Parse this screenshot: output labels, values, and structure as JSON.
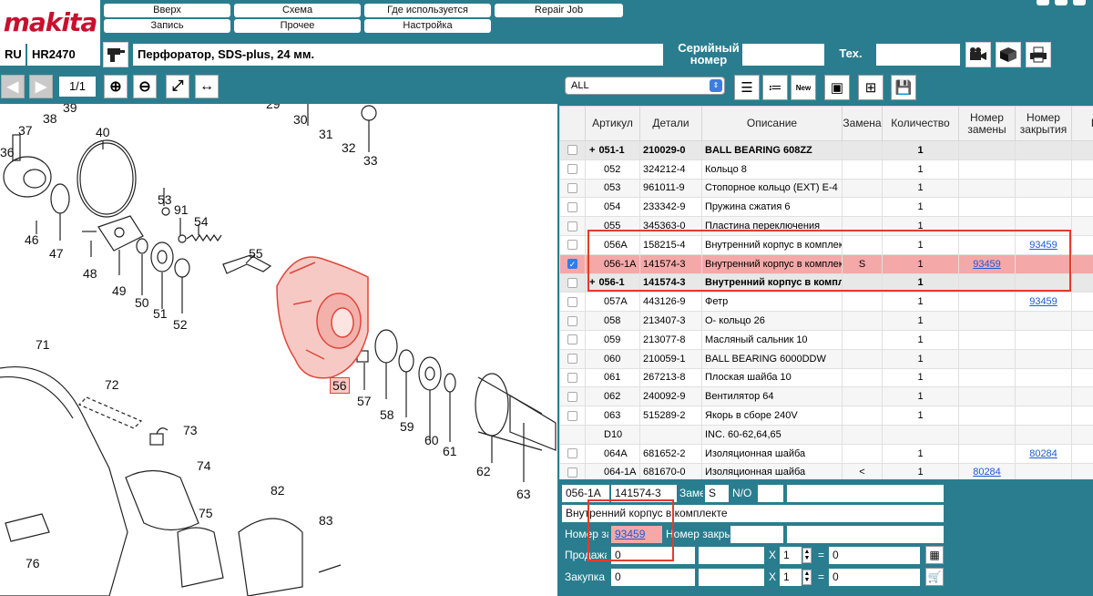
{
  "logo": {
    "brand": "makita"
  },
  "menu": {
    "up": "Вверх",
    "scheme": "Схема",
    "where_used": "Где используется",
    "repair_job": "Repair Job",
    "record": "Запись",
    "other": "Прочее",
    "settings": "Настройка"
  },
  "model_row": {
    "lang": "RU",
    "model": "HR2470",
    "description": "Перфоратор, SDS-plus, 24 мм.",
    "serial_label_1": "Серийный",
    "serial_label_2": "номер",
    "serial_value": "",
    "tech_label": "Тех.",
    "tech_value": ""
  },
  "drawing_toolbar": {
    "page": "1/1",
    "prev_icon": "arrow-left-icon",
    "next_icon": "arrow-right-icon",
    "zoom_in_icon": "plus-circle-icon",
    "zoom_out_icon": "minus-circle-icon",
    "fit_icon": "expand-icon",
    "width_icon": "fit-width-icon"
  },
  "drawing": {
    "callouts": [
      "37",
      "38",
      "39",
      "29",
      "30",
      "31",
      "32",
      "33",
      "40",
      "36",
      "46",
      "47",
      "53",
      "91",
      "54",
      "55",
      "48",
      "49",
      "50",
      "51",
      "52",
      "56",
      "57",
      "58",
      "59",
      "60",
      "61",
      "62",
      "63",
      "71",
      "72",
      "73",
      "74",
      "82",
      "83",
      "75",
      "76"
    ],
    "highlighted": "56"
  },
  "parts_toolbar": {
    "filter": "ALL",
    "new_label": "New"
  },
  "grid": {
    "headers": [
      "Артикул",
      "Детали",
      "Описание",
      "Замена",
      "Количество",
      "Номер замены",
      "Номер закрытия",
      "Пр"
    ],
    "rows": [
      {
        "checked": false,
        "plus": "+",
        "art": "051-1",
        "part": "210029-0",
        "desc": "BALL BEARING 608ZZ",
        "repl": "",
        "qty": "1",
        "repl_no": "",
        "close_no": "",
        "style": "bold group"
      },
      {
        "checked": false,
        "plus": "",
        "art": "052",
        "part": "324212-4",
        "desc": "Кольцо 8",
        "repl": "",
        "qty": "1",
        "repl_no": "",
        "close_no": "",
        "style": ""
      },
      {
        "checked": false,
        "plus": "",
        "art": "053",
        "part": "961011-9",
        "desc": "Стопорное кольцо (EXT) E-4",
        "repl": "",
        "qty": "1",
        "repl_no": "",
        "close_no": "",
        "style": "alt"
      },
      {
        "checked": false,
        "plus": "",
        "art": "054",
        "part": "233342-9",
        "desc": "Пружина сжатия 6",
        "repl": "",
        "qty": "1",
        "repl_no": "",
        "close_no": "",
        "style": ""
      },
      {
        "checked": false,
        "plus": "",
        "art": "055",
        "part": "345363-0",
        "desc": "Пластина переключения",
        "repl": "",
        "qty": "1",
        "repl_no": "",
        "close_no": "",
        "style": "alt"
      },
      {
        "checked": false,
        "plus": "",
        "art": "056A",
        "part": "158215-4",
        "desc": "Внутренний корпус в комплекте",
        "repl": "",
        "qty": "1",
        "repl_no": "",
        "close_no": "93459",
        "style": ""
      },
      {
        "checked": true,
        "plus": "",
        "art": "056-1A",
        "part": "141574-3",
        "desc": "Внутренний корпус в комплекте",
        "repl": "S",
        "qty": "1",
        "repl_no": "93459",
        "close_no": "",
        "style": "sel"
      },
      {
        "checked": false,
        "plus": "+",
        "art": "056-1",
        "part": "141574-3",
        "desc": "Внутренний корпус в комплекте",
        "repl": "",
        "qty": "1",
        "repl_no": "",
        "close_no": "",
        "style": "bold group"
      },
      {
        "checked": false,
        "plus": "",
        "art": "057A",
        "part": "443126-9",
        "desc": "Фетр",
        "repl": "",
        "qty": "1",
        "repl_no": "",
        "close_no": "93459",
        "style": ""
      },
      {
        "checked": false,
        "plus": "",
        "art": "058",
        "part": "213407-3",
        "desc": "О- кольцо 26",
        "repl": "",
        "qty": "1",
        "repl_no": "",
        "close_no": "",
        "style": "alt"
      },
      {
        "checked": false,
        "plus": "",
        "art": "059",
        "part": "213077-8",
        "desc": "Масляный сальник 10",
        "repl": "",
        "qty": "1",
        "repl_no": "",
        "close_no": "",
        "style": ""
      },
      {
        "checked": false,
        "plus": "",
        "art": "060",
        "part": "210059-1",
        "desc": "BALL BEARING 6000DDW",
        "repl": "",
        "qty": "1",
        "repl_no": "",
        "close_no": "",
        "style": "alt"
      },
      {
        "checked": false,
        "plus": "",
        "art": "061",
        "part": "267213-8",
        "desc": "Плоская шайба 10",
        "repl": "",
        "qty": "1",
        "repl_no": "",
        "close_no": "",
        "style": ""
      },
      {
        "checked": false,
        "plus": "",
        "art": "062",
        "part": "240092-9",
        "desc": "Вентилятор 64",
        "repl": "",
        "qty": "1",
        "repl_no": "",
        "close_no": "",
        "style": "alt"
      },
      {
        "checked": false,
        "plus": "",
        "art": "063",
        "part": "515289-2",
        "desc": "Якорь в сборе 240V",
        "repl": "",
        "qty": "1",
        "repl_no": "",
        "close_no": "",
        "style": ""
      },
      {
        "checked": null,
        "plus": "",
        "art": "D10",
        "part": "",
        "desc": "INC. 60-62,64,65",
        "repl": "",
        "qty": "",
        "repl_no": "",
        "close_no": "",
        "style": "alt"
      },
      {
        "checked": false,
        "plus": "",
        "art": "064A",
        "part": "681652-2",
        "desc": "Изоляционная шайба",
        "repl": "",
        "qty": "1",
        "repl_no": "",
        "close_no": "80284",
        "style": ""
      },
      {
        "checked": false,
        "plus": "",
        "art": "064-1A",
        "part": "681670-0",
        "desc": "Изоляционная шайба",
        "repl": "<",
        "qty": "1",
        "repl_no": "80284",
        "close_no": "",
        "style": "alt"
      }
    ]
  },
  "detail": {
    "art": "056-1A",
    "part": "141574-3",
    "repl_label": "Замена",
    "repl_value": "S",
    "no_label": "N/O",
    "no_value": "",
    "description": "Внутренний корпус в комплекте",
    "repl_no_label": "Номер замены",
    "repl_no_value": "93459",
    "close_no_label": "Номер закрытия",
    "close_no_value": "",
    "sale_label": "Продажа",
    "sale_value": "0",
    "sale_qty": "1",
    "sale_total": "0",
    "buy_label": "Закупка",
    "buy_value": "0",
    "buy_qty": "1",
    "buy_total": "0",
    "mult": "X",
    "eq": "="
  },
  "colors": {
    "background": "#2a7d8f",
    "brand_red": "#c8102e",
    "selection": "#f4a8a8",
    "annotation_red": "#e53b2c",
    "link": "#1a5ad8"
  }
}
